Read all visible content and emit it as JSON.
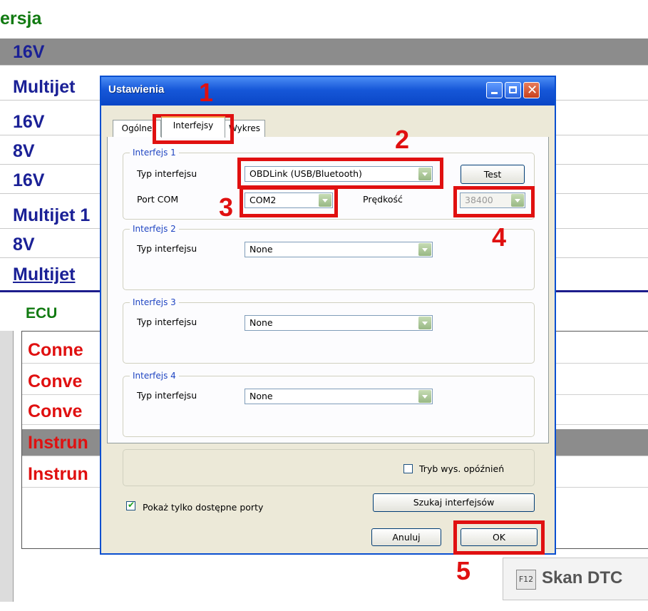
{
  "background": {
    "title_fragment": "ersja",
    "rows": [
      "16V",
      "Multijet",
      "16V",
      "8V",
      "16V",
      "Multijet 1",
      "8V",
      "Multijet"
    ],
    "ecu_label": "ECU",
    "ecu_rows": [
      "Conne",
      "Conve",
      "Conve",
      "Instrun",
      "Instrun"
    ],
    "skan_key": "F12",
    "skan_label": "Skan DTC"
  },
  "dialog": {
    "title": "Ustawienia",
    "tabs": [
      "Ogólne",
      "Interfejsy",
      "Wykres"
    ],
    "active_tab": "Interfejsy",
    "groups": [
      {
        "label": "Interfejs 1",
        "type_label": "Typ interfejsu",
        "type_value": "OBDLink (USB/Bluetooth)",
        "port_label": "Port COM",
        "port_value": "COM2",
        "speed_label": "Prędkość",
        "speed_value": "38400",
        "test_button": "Test"
      },
      {
        "label": "Interfejs 2",
        "type_label": "Typ interfejsu",
        "type_value": "None"
      },
      {
        "label": "Interfejs 3",
        "type_label": "Typ interfejsu",
        "type_value": "None"
      },
      {
        "label": "Interfejs 4",
        "type_label": "Typ interfejsu",
        "type_value": "None"
      }
    ],
    "delay_checkbox": "Tryb wys. opóźnień",
    "delay_checked": false,
    "show_ports_checkbox": "Pokaż tylko dostępne porty",
    "show_ports_checked": true,
    "search_button": "Szukaj interfejsów",
    "cancel_button": "Anuluj",
    "ok_button": "OK"
  },
  "annotations": [
    "1",
    "2",
    "3",
    "4",
    "5"
  ],
  "colors": {
    "annotation": "#e01010",
    "titlebar": "#1657d8",
    "group_label": "#1f45c2"
  }
}
